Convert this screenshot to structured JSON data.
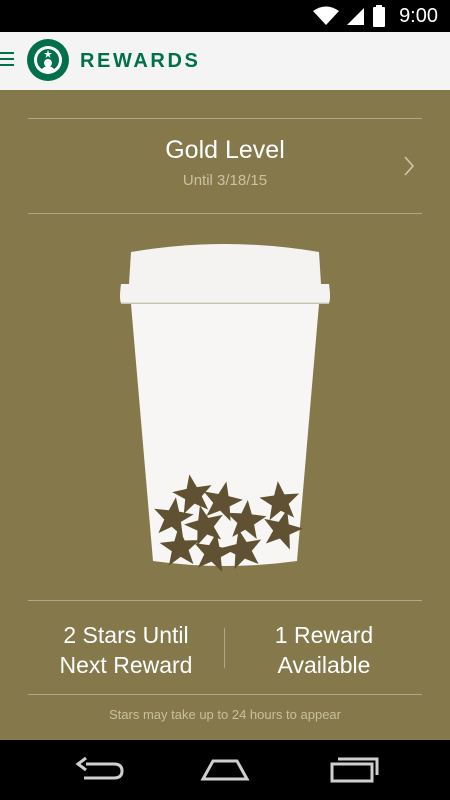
{
  "status_bar": {
    "time": "9:00"
  },
  "app_bar": {
    "title": "REWARDS"
  },
  "level": {
    "title": "Gold Level",
    "until": "Until 3/18/15"
  },
  "stats": {
    "stars_until_line1": "2 Stars Until",
    "stars_until_line2": "Next Reward",
    "rewards_line1": "1 Reward",
    "rewards_line2": "Available"
  },
  "footnote": "Stars may take up to 24 hours to appear",
  "colors": {
    "background": "#85794c",
    "brand_green": "#00704a",
    "star": "#5f5131",
    "cup": "#f7f6f4"
  },
  "stars_collected": 10
}
